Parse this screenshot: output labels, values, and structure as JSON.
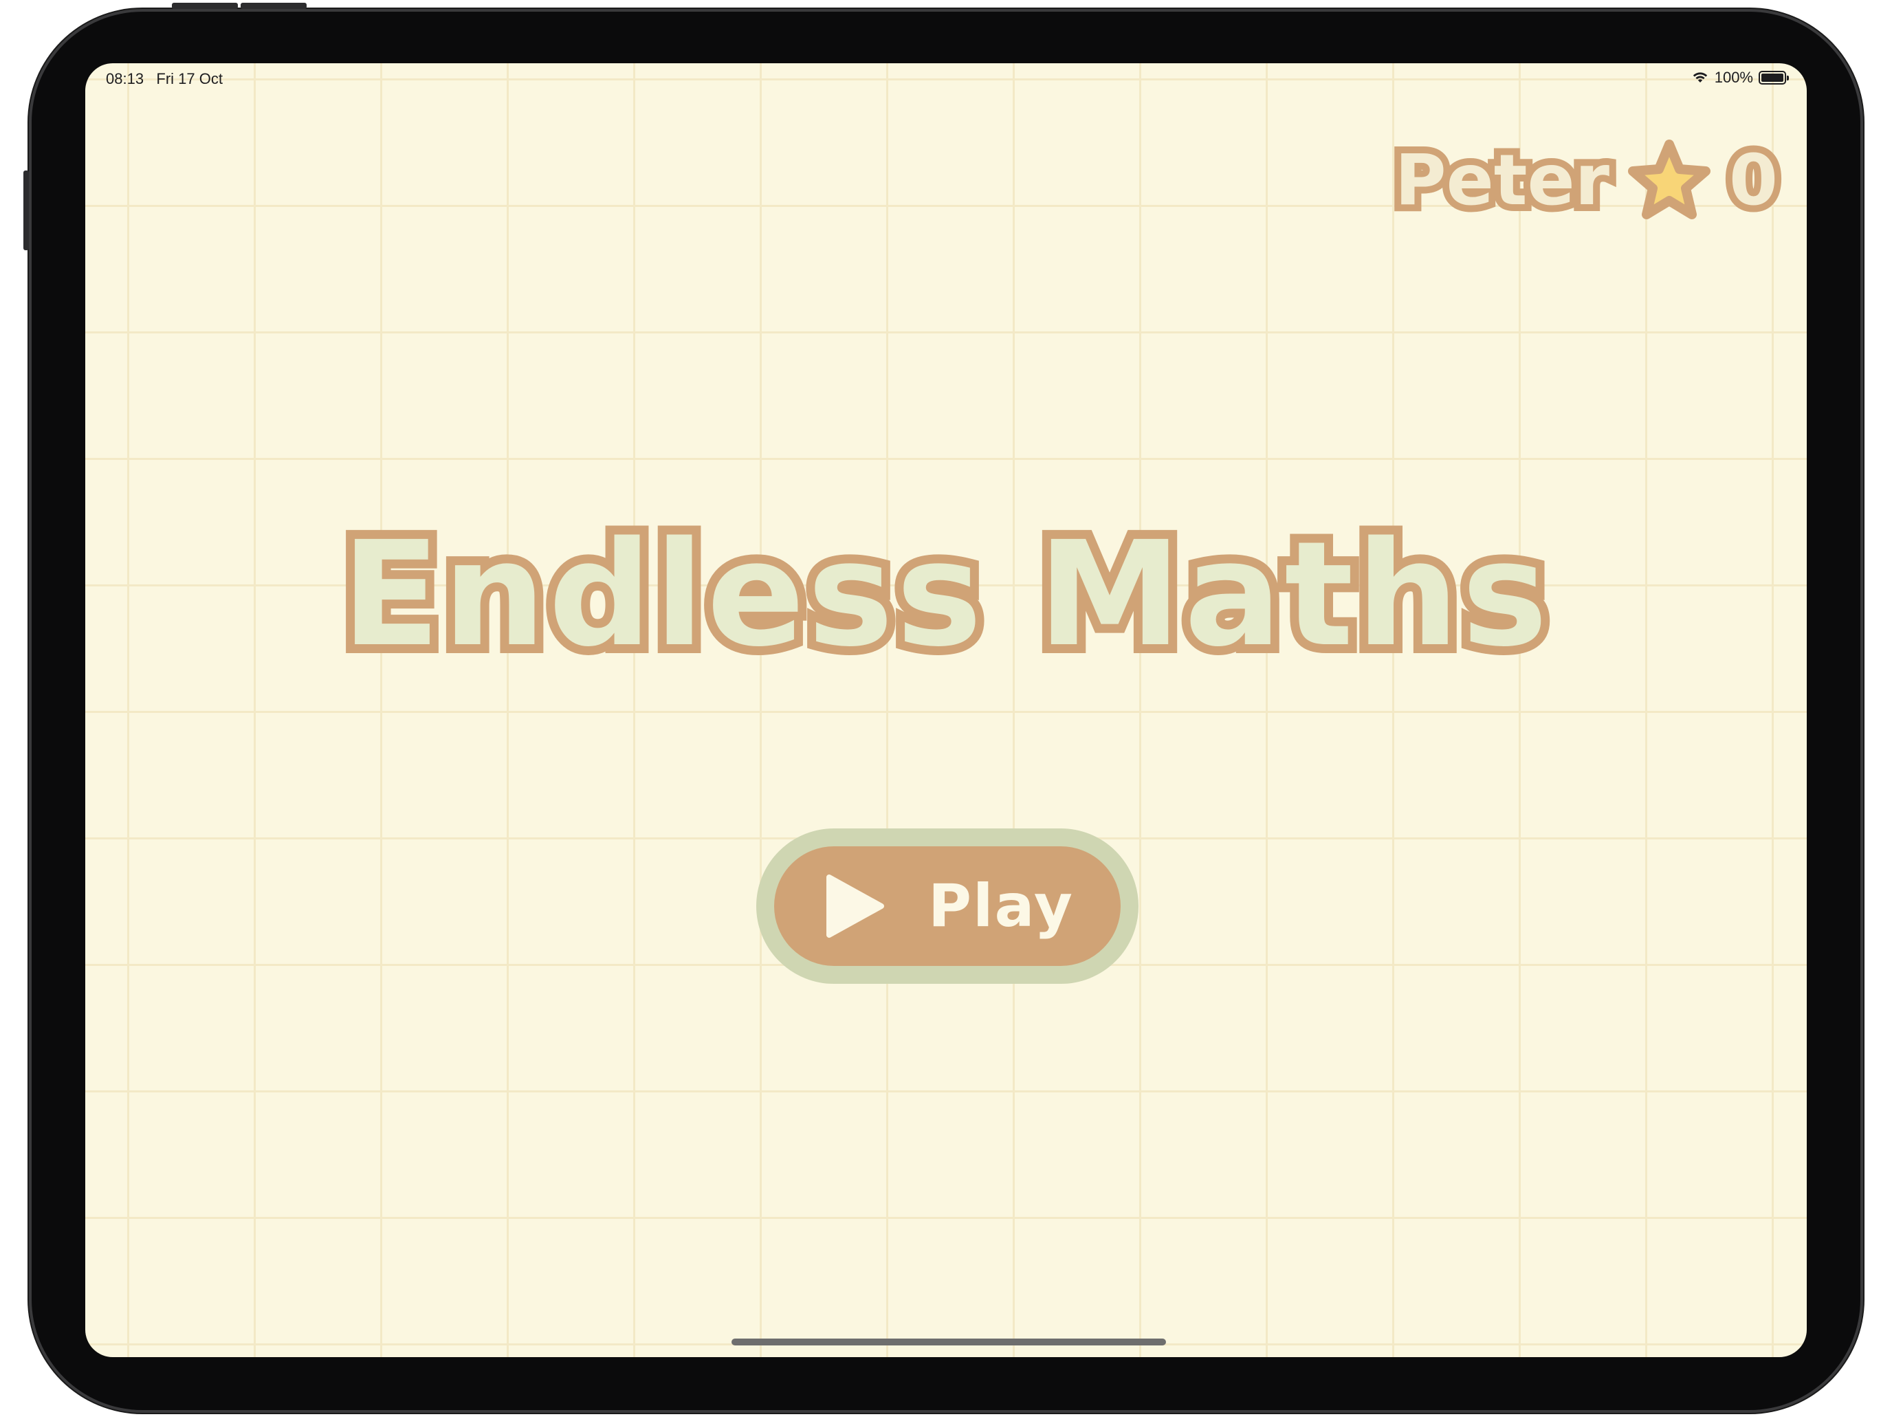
{
  "status_bar": {
    "time": "08:13",
    "date": "Fri 17 Oct",
    "battery_percent": "100%",
    "battery_level": 1.0,
    "wifi_icon": "wifi-icon",
    "battery_icon": "battery-icon"
  },
  "player": {
    "name": "Peter",
    "star_icon": "star-icon",
    "score": "0"
  },
  "title": "Endless Maths",
  "play_button": {
    "icon": "play-icon",
    "label": "Play"
  },
  "colors": {
    "background": "#fbf7e0",
    "grid_line": "#f3e9c6",
    "outline_brown": "#d0a376",
    "title_fill": "#e7ecce",
    "button_border": "#cfd6b2",
    "button_label": "#fcf8e6",
    "star_fill": "#f8d577"
  }
}
